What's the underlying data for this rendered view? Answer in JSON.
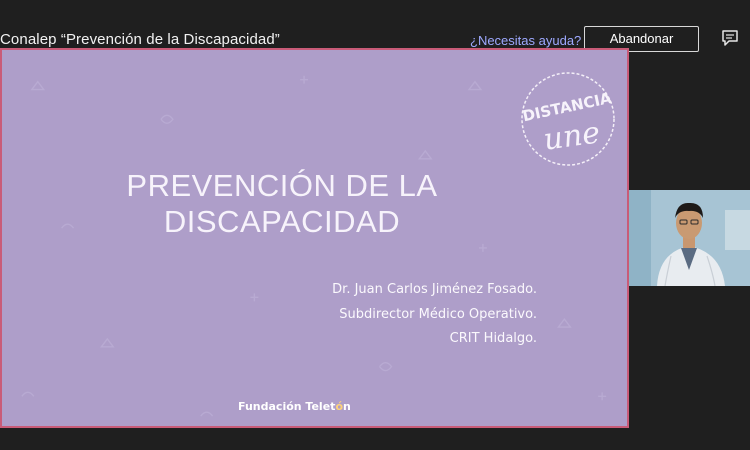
{
  "window": {
    "meeting_title": "Conalep “Prevención de la Discapacidad”",
    "help_link": "¿Necesitas ayuda?",
    "leave_label": "Abandonar",
    "chat_icon": "chat-bubble-icon"
  },
  "slide": {
    "heading_lines": [
      "PREVENCIÓN DE LA",
      "DISCAPACIDAD"
    ],
    "presenter": {
      "name": "Dr. Juan Carlos Jiménez Fosado.",
      "role": "Subdirector Médico Operativo.",
      "center": "CRIT Hidalgo."
    },
    "foundation": {
      "prefix": "Fundación Telet",
      "highlight": "ó",
      "suffix": "n"
    },
    "logo": {
      "line1": "DISTANCIA",
      "line2": "une"
    },
    "background_color": "#ae9ec9",
    "border_color": "#c95b78"
  },
  "colors": {
    "app_background": "#1f1f1f",
    "link": "#9ea9ff"
  }
}
